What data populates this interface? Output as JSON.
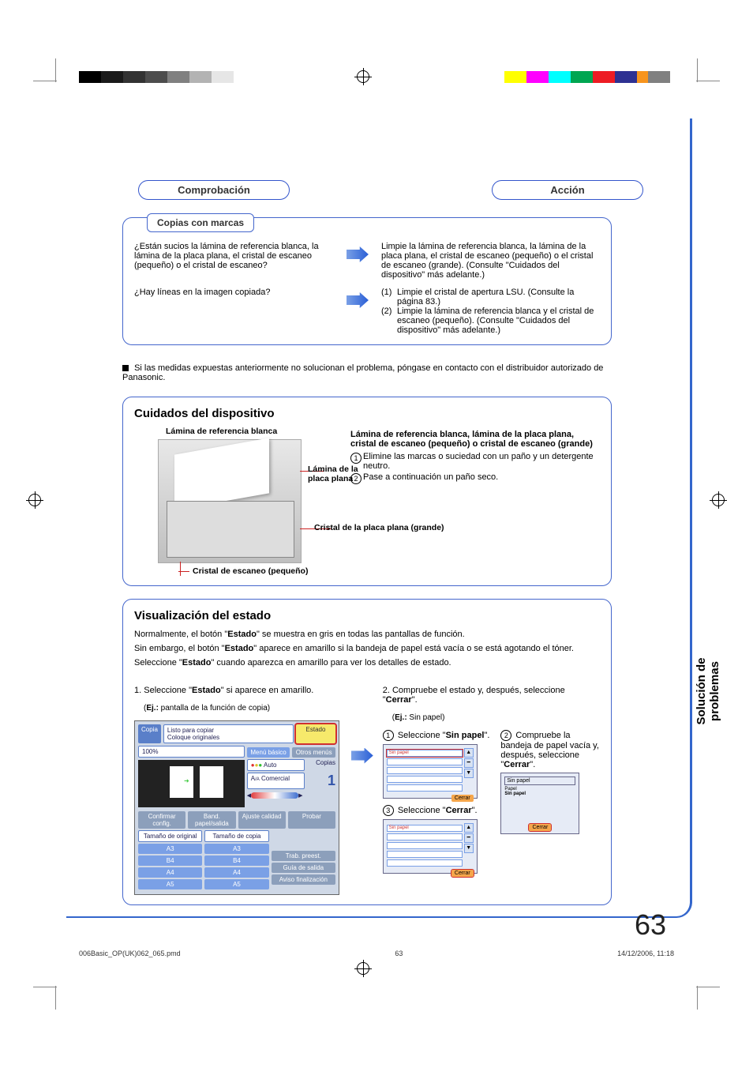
{
  "crop": {
    "top_reg": true
  },
  "headings": {
    "check": "Comprobación",
    "action": "Acción"
  },
  "marks_box": {
    "title": "Copias con marcas",
    "q1": "¿Están sucios la lámina de referencia blanca, la lámina de la placa plana, el cristal de escaneo (pequeño) o el cristal de escaneo?",
    "a1": "Limpie la lámina de referencia blanca, la lámina de la placa plana, el cristal de escaneo (pequeño) o el cristal de escaneo (grande). (Consulte \"Cuidados del dispositivo\" más adelante.)",
    "q2": "¿Hay líneas en la imagen copiada?",
    "a2_1": "Limpie el cristal de apertura LSU. (Consulte la página 83.)",
    "a2_2": "Limpie la lámina de referencia blanca y el cristal de escaneo (pequeño). (Consulte \"Cuidados del dispositivo\" más adelante.)"
  },
  "service_note": "Si las medidas expuestas anteriormente no solucionan el problema, póngase en contacto con el distribuidor autorizado de Panasonic.",
  "care": {
    "title": "Cuidados del dispositivo",
    "label_white_sheet": "Lámina de referencia blanca",
    "label_platen_sheet": "Lámina de la placa plana",
    "label_platen_glass": "Cristal de la placa plana (grande)",
    "label_scan_glass": "Cristal de escaneo (pequeño)",
    "right_title": "Lámina de referencia blanca, lámina de la placa plana, cristal de escaneo (pequeño) o cristal de escaneo (grande)",
    "step1": "Elimine las marcas o suciedad con un paño y un detergente neutro.",
    "step2": "Pase a continuación un paño seco."
  },
  "status": {
    "title": "Visualización del estado",
    "intro1_a": "Normalmente, el botón \"",
    "intro1_bold1": "Estado",
    "intro1_b": "\" se muestra en gris en todas las pantallas de función.",
    "intro2_a": "Sin embargo, el botón \"",
    "intro2_bold": "Estado",
    "intro2_b": "\" aparece en amarillo si la bandeja de papel está vacía o se está agotando el tóner.",
    "intro3_a": "Seleccione \"",
    "intro3_bold": "Estado",
    "intro3_b": "\" cuando aparezca en amarillo para ver los detalles de estado.",
    "step1_a": "Seleccione \"",
    "step1_bold": "Estado",
    "step1_b": "\" si aparece en amarillo.",
    "step1_ex_label": "Ej.:",
    "step1_ex": " pantalla de la función de copia)",
    "step2": "Compruebe el estado y, después, seleccione \"",
    "step2_bold": "Cerrar",
    "step2_end": "\".",
    "step2_ex_label": "Ej.:",
    "step2_ex": " Sin papel)",
    "sub1_a": "Seleccione \"",
    "sub1_bold": "Sin papel",
    "sub1_b": "\".",
    "sub2": "Compruebe la bandeja de papel vacía y, después, seleccione",
    "sub2_bold": "Cerrar",
    "sub3_a": "Seleccione \"",
    "sub3_bold": "Cerrar",
    "sub3_b": "\"."
  },
  "copy_panel": {
    "tab": "Copia",
    "ready": "Listo para copiar",
    "place": "Coloque originales",
    "estado": "Estado",
    "zoom": "100%",
    "menu_basic": "Menú básico",
    "other": "Otros menús",
    "auto": "Auto",
    "copias": "Copias",
    "comercial": "Comercial",
    "count": "1",
    "confirm": "Confirmar config.",
    "tray": "Band. papel/salida",
    "quality": "Ajuste calidad",
    "probe": "Probar",
    "orig_size": "Tamaño de original",
    "copy_size": "Tamaño de copia",
    "sizes": [
      "A3",
      "B4",
      "A4",
      "A5"
    ],
    "preset": "Trab. preest.",
    "output": "Guía de salida",
    "notify": "Aviso finalización"
  },
  "mini_panels": {
    "no_paper": "Sin papel",
    "close": "Cerrar",
    "paper": "Papel",
    "wo_paper": "Sin papel",
    "out_paper": "Sin papel"
  },
  "side_tab": {
    "line1": "Solución de",
    "line2": "problemas"
  },
  "page_number": "63",
  "footer": {
    "file": "006Basic_OP(UK)062_065.pmd",
    "pg": "63",
    "date": "14/12/2006, 11:18"
  }
}
